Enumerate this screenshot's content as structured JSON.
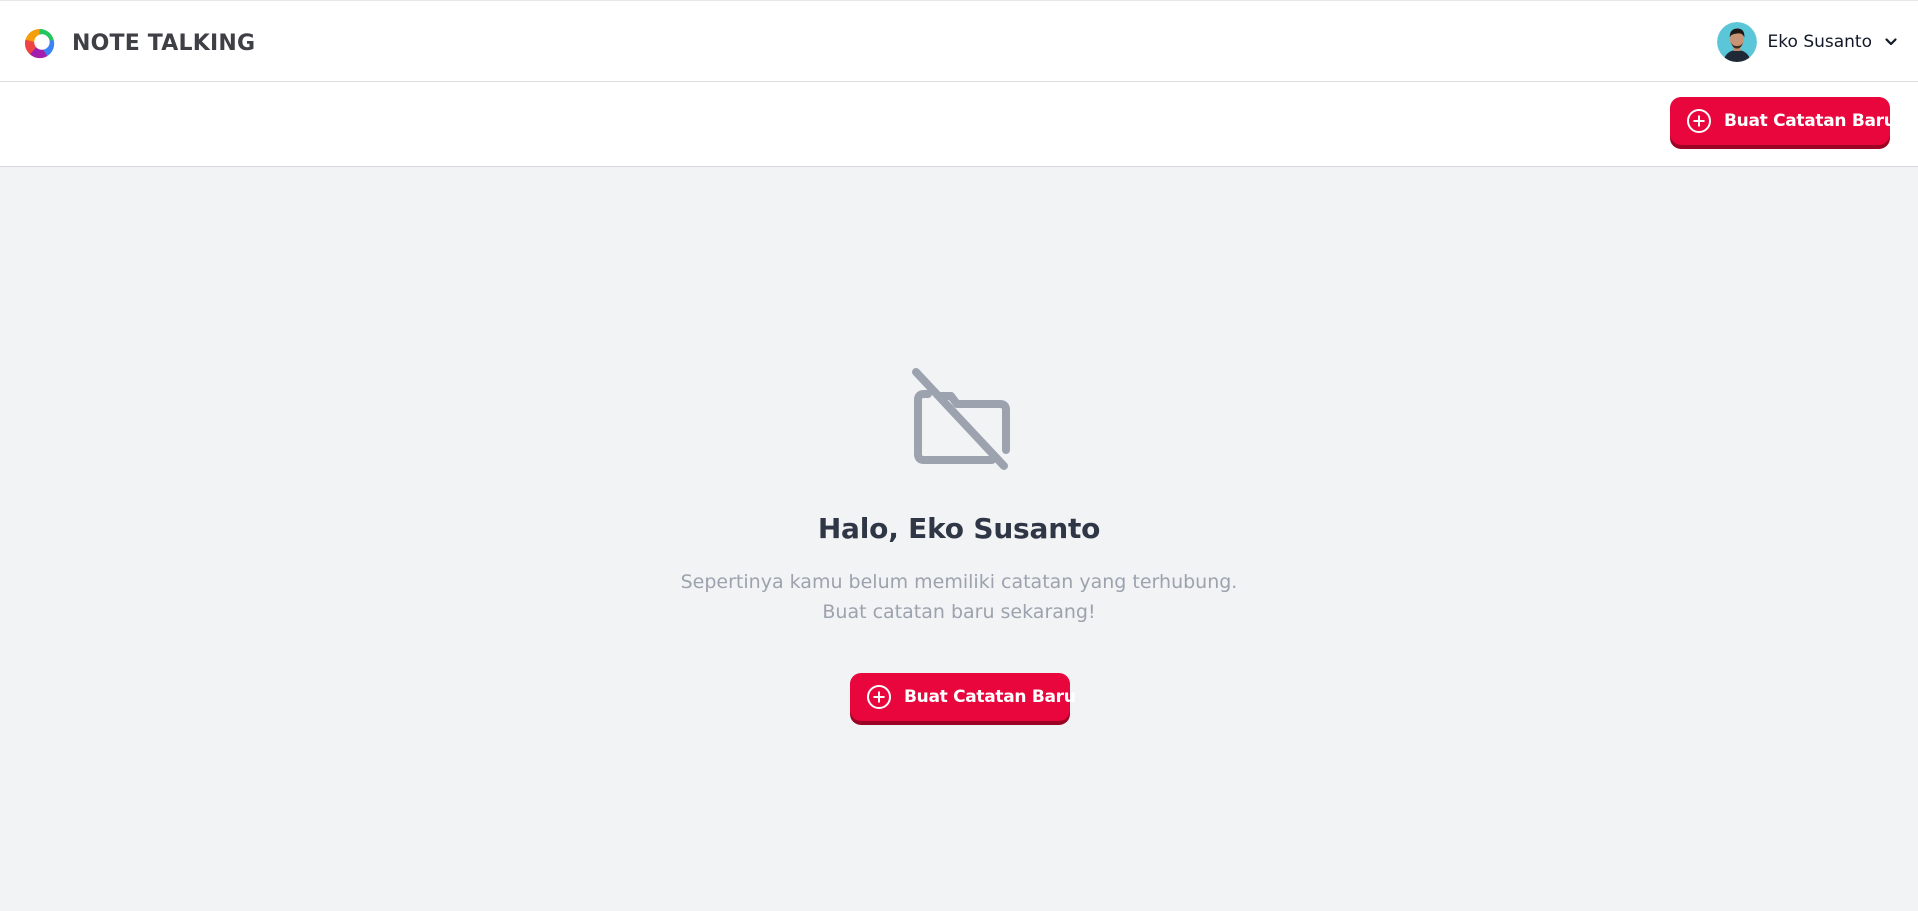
{
  "header": {
    "brand_name": "NOTE TALKING",
    "user_name": "Eko Susanto",
    "logo_icon": "app-logo-icon",
    "menu_icon": "chevron-down-icon"
  },
  "toolbar": {
    "new_note_label": "Buat Catatan Baru",
    "new_note_icon": "plus-circle-icon"
  },
  "empty_state": {
    "icon": "folder-off-icon",
    "greeting": "Halo, Eko Susanto",
    "message_line1": "Sepertinya kamu belum memiliki catatan yang terhubung.",
    "message_line2": "Buat catatan baru sekarang!",
    "cta_label": "Buat Catatan Baru"
  },
  "colors": {
    "accent": "#e8063c",
    "accent_shadow": "#9c0426",
    "background": "#f2f3f5",
    "muted_text": "#9ca3af",
    "heading_text": "#2f3645"
  }
}
